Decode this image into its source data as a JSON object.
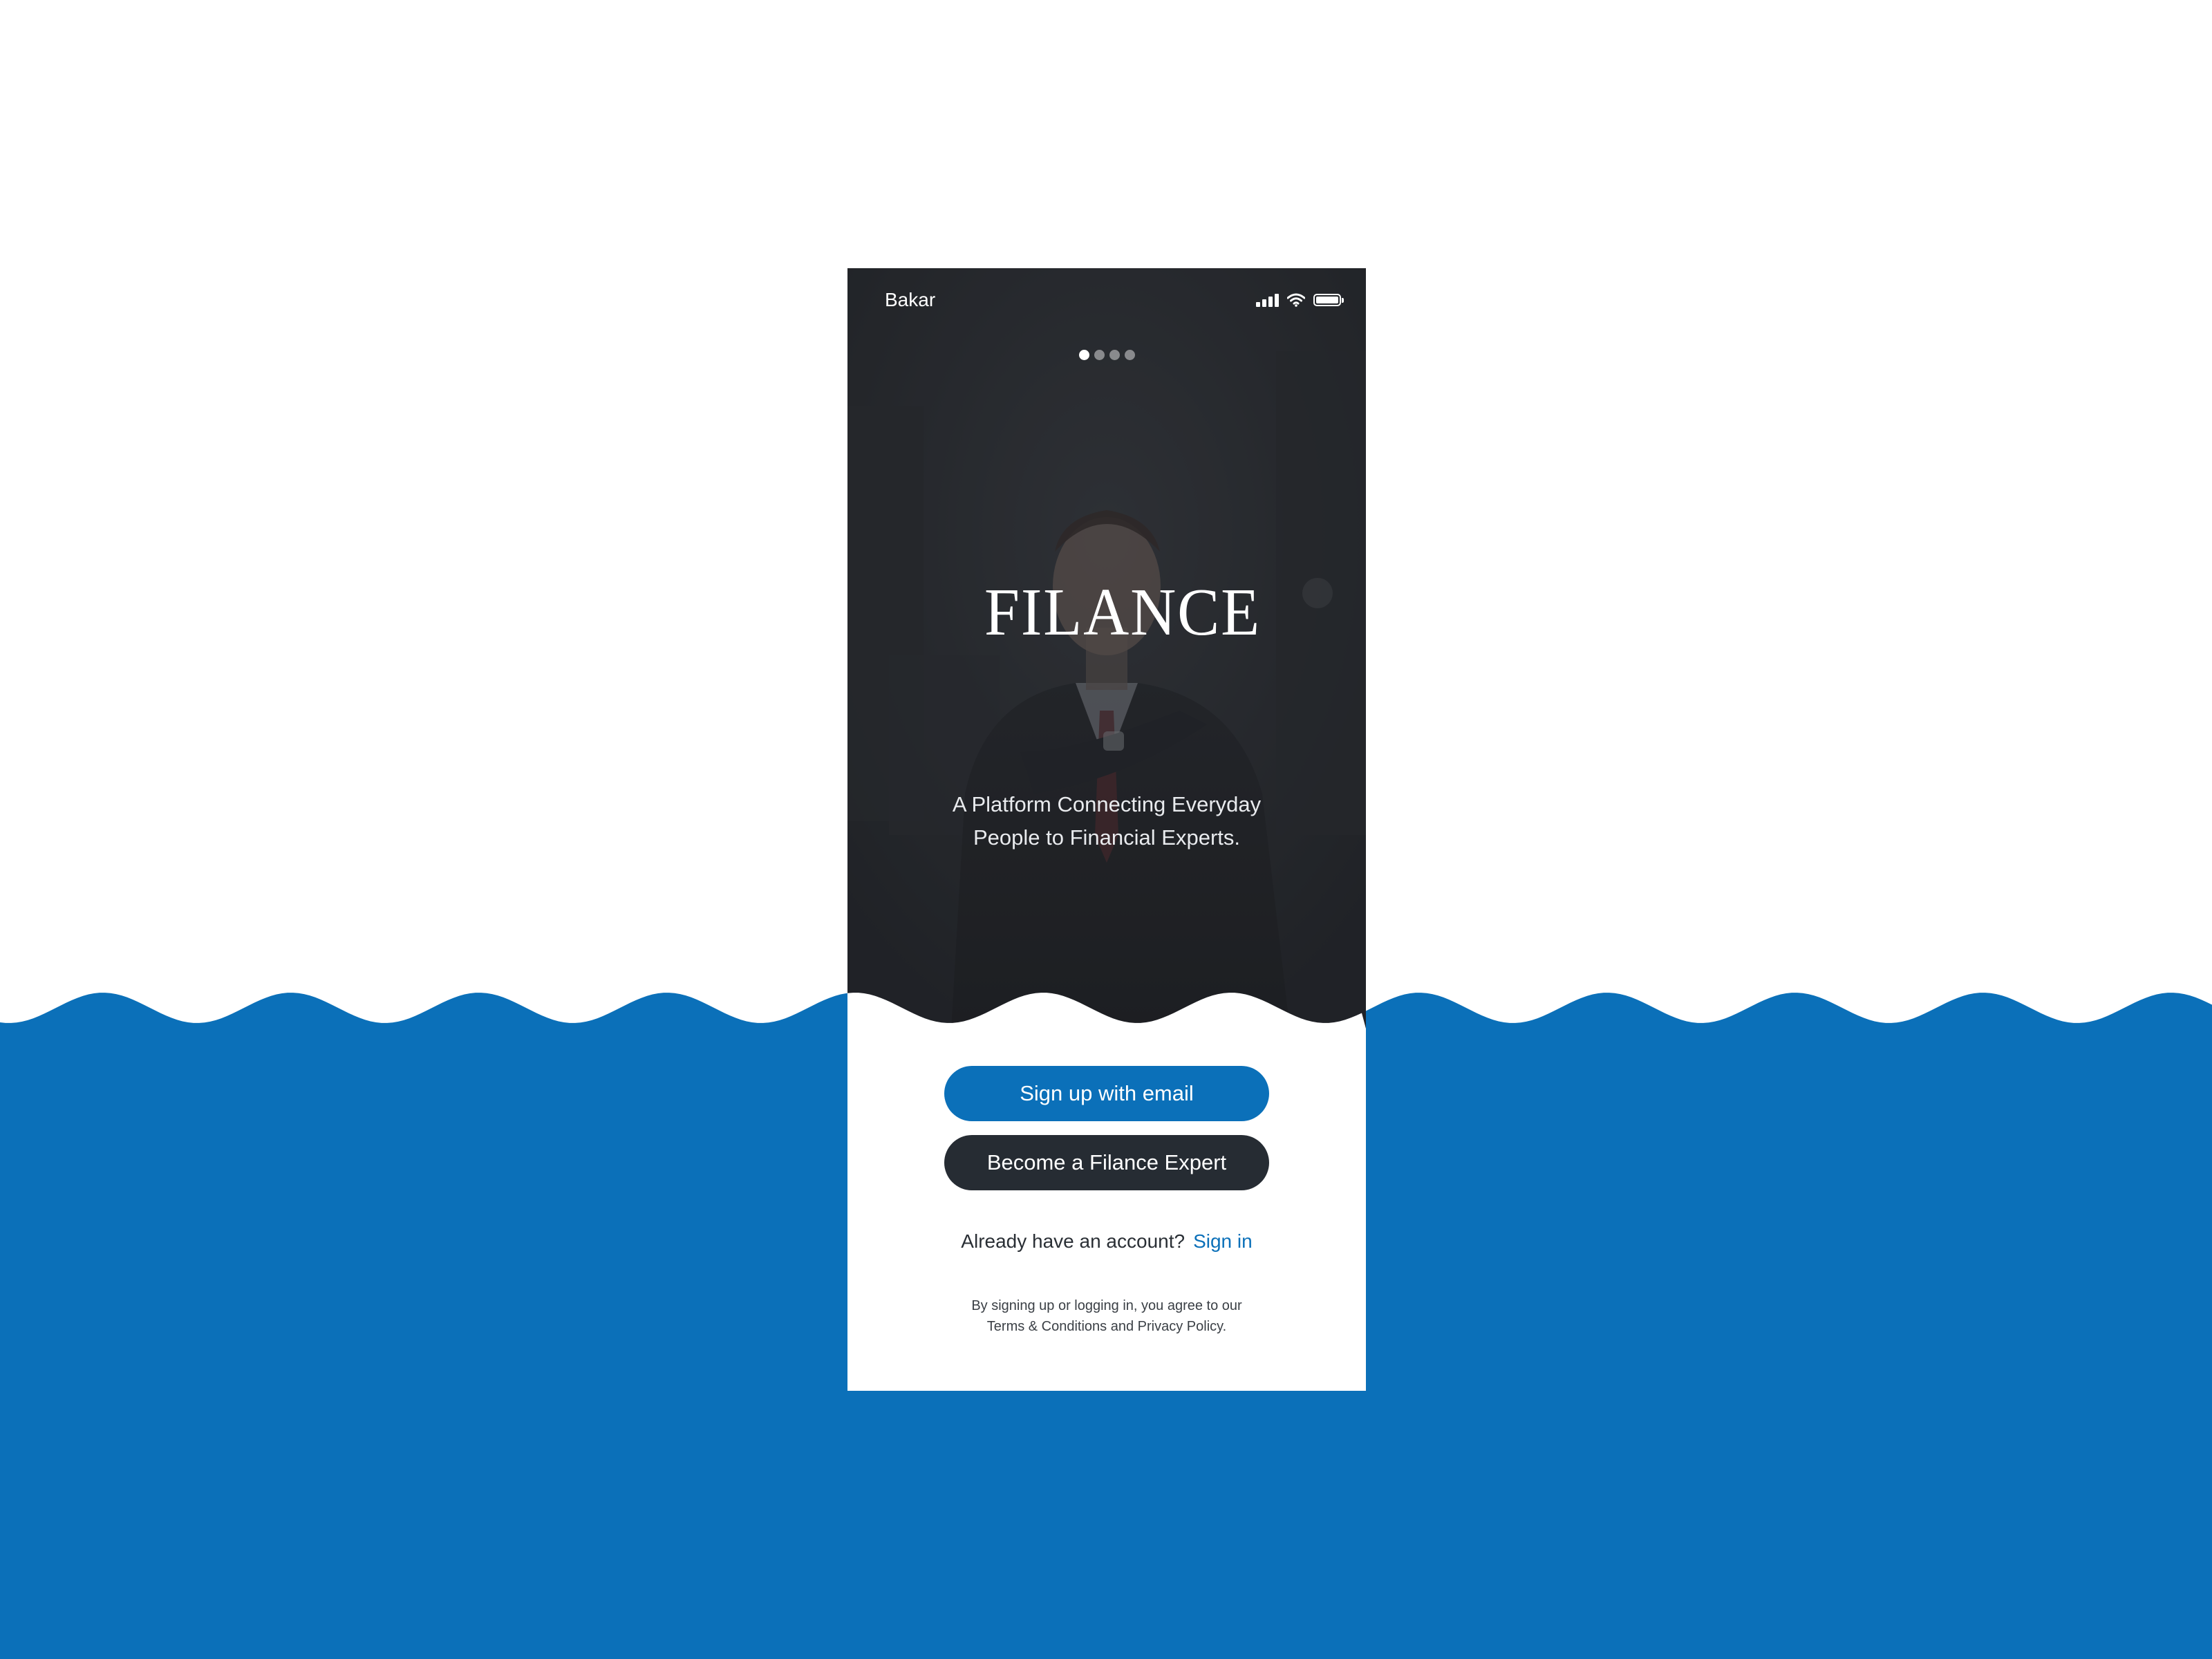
{
  "status_bar": {
    "carrier": "Bakar",
    "icons": [
      "signal-icon",
      "wifi-icon",
      "battery-icon"
    ]
  },
  "onboarding": {
    "pager_total": 4,
    "pager_active_index": 0,
    "brand_name": "FILANCE",
    "tagline_line1": "A Platform Connecting Everyday",
    "tagline_line2": "People to Financial Experts."
  },
  "actions": {
    "signup_label": "Sign up with email",
    "expert_label": "Become a Filance Expert",
    "already_account": "Already have an account?",
    "signin_label": "Sign in"
  },
  "legal": {
    "line1": "By signing up or logging in, you agree to our",
    "line2": "Terms & Conditions and Privacy Policy."
  },
  "colors": {
    "brand_blue": "#0b70b9",
    "dark": "#262c33",
    "background": "#ffffff"
  }
}
